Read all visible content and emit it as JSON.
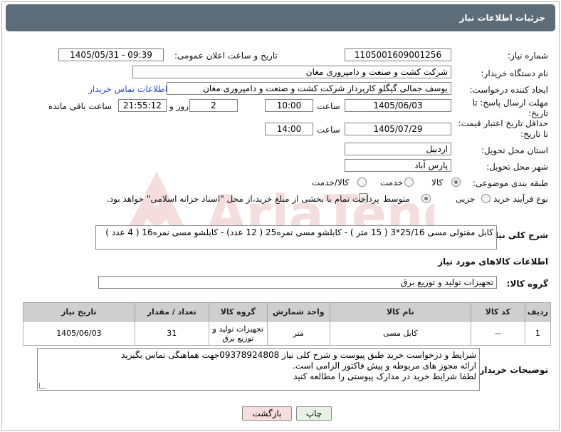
{
  "header": {
    "title": "جزئیات اطلاعات نیاز"
  },
  "fields": {
    "need_number_label": "شماره نیاز:",
    "need_number": "1105001609001256",
    "announce_label": "تاریخ و ساعت اعلان عمومی:",
    "announce_value": "1405/05/31 - 09:39",
    "buyer_org_label": "نام دستگاه خریدار:",
    "buyer_org": "شرکت کشت و صنعت و دامپروری مغان",
    "creator_label": "ایجاد کننده درخواست:",
    "creator": "یوسف جمالی گیگلو کارپرداز شرکت کشت و صنعت و دامپروری مغان",
    "contact_link": "اطلاعات تماس خریدار",
    "deadline_label": "مهلت ارسال پاسخ: تا تاریخ:",
    "deadline_date": "1405/06/03",
    "time_label": "ساعت",
    "deadline_time": "10:00",
    "days_value": "2",
    "days_label": "روز و",
    "remaining_time": "21:55:12",
    "remaining_label": "ساعت باقی مانده",
    "min_price_label": "حداقل تاریخ اعتبار قیمت: تا تاریخ:",
    "min_price_date": "1405/07/29",
    "min_price_time": "14:00",
    "province_label": "استان محل تحویل:",
    "province": "اردبیل",
    "city_label": "شهر محل تحویل:",
    "city": "پارس آباد",
    "category_label": "طبقه بندی موضوعی:",
    "category_options": [
      "کالا",
      "خدمت",
      "کالا/خدمت"
    ],
    "process_label": "نوع فرآیند خرید :",
    "process_options": [
      "جزیی",
      "متوسط"
    ],
    "payment_note": "پرداخت تمام یا بخشی از مبلغ خرید،از محل \"اسناد خزانه اسلامی\" خواهد بود."
  },
  "description": {
    "label": "شرح کلی نیاز:",
    "text": "کابل مفتولی مسی 25/16*3  ( 15 متر ) -  کابلشو مسی نمره25  ( 12 عدد)   -  کابلشو مسی نمره16  ( 4 عدد )"
  },
  "goods_info_title": "اطلاعات کالاهای مورد نیاز",
  "goods_group": {
    "label": "گروه کالا:",
    "value": "تجهیزات تولید و توزیع برق"
  },
  "table": {
    "headers": [
      "ردیف",
      "کد کالا",
      "نام کالا",
      "واحد شمارش",
      "گروه کالا",
      "تعداد / مقدار",
      "تاریخ نیاز"
    ],
    "rows": [
      [
        "1",
        "--",
        "کابل مسی",
        "متر",
        "تجهیزات تولید و توزیع برق",
        "31",
        "1405/06/03"
      ]
    ]
  },
  "buyer_notes": {
    "label": "توضیحات خریدار:",
    "lines": [
      "شرایط و درخواست خرید طبق پیوست و شرح کلی نیاز 09378924808جهت هماهنگی تماس بگیرید",
      "ارائه مجوز های مربوطه و پیش فاکتور الزامی است.",
      "لطفا شرایط خرید در مدارک پیوستی را مطالعه کنید"
    ]
  },
  "buttons": {
    "print": "چاپ",
    "back": "بازگشت"
  },
  "watermark": {
    "text": "AriaTender.net"
  },
  "colors": {
    "header_bg": "#5d6c79",
    "link": "#2a4bd0",
    "table_header": "#cfcfcf",
    "back_btn": "#f6dede",
    "print_btn": "#e8f2e4"
  }
}
